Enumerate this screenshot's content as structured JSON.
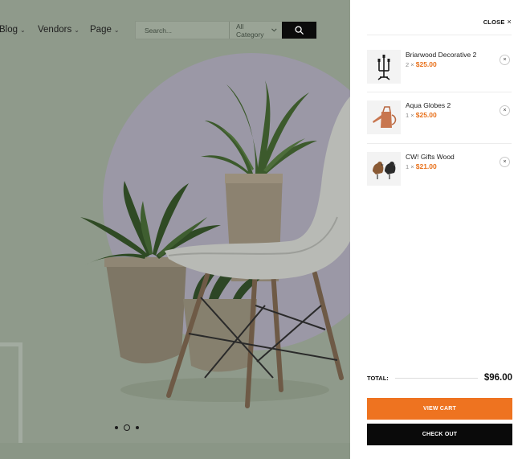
{
  "nav": {
    "items": [
      {
        "label": "Blog"
      },
      {
        "label": "Vendors"
      },
      {
        "label": "Page"
      }
    ],
    "chevron": "⌄"
  },
  "search": {
    "placeholder": "Search...",
    "category": "All Category",
    "button_icon": "search-icon"
  },
  "carousel": {
    "slides": 3,
    "active_index": 1
  },
  "drawer": {
    "close_label": "CLOSE",
    "close_icon": "×",
    "items": [
      {
        "name": "Briarwood Decorative 2",
        "qty": "2",
        "price": "$25.00",
        "icon": "candle-holder-icon"
      },
      {
        "name": "Aqua Globes 2",
        "qty": "1",
        "price": "$25.00",
        "icon": "watering-can-icon"
      },
      {
        "name": "CW! Gifts Wood",
        "qty": "1",
        "price": "$21.00",
        "icon": "wooden-birds-icon"
      }
    ],
    "remove_icon": "×",
    "total_label": "TOTAL:",
    "total_value": "$96.00",
    "view_cart_label": "VIEW CART",
    "checkout_label": "CHECK OUT"
  },
  "colors": {
    "accent": "#ee7320",
    "dark": "#0a0a0a",
    "price": "#e8701a"
  }
}
